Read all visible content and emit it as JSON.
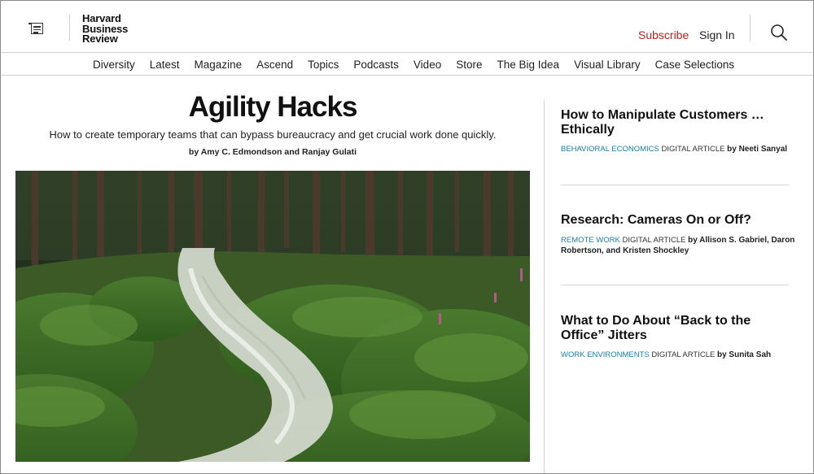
{
  "header": {
    "logo_lines": [
      "Harvard",
      "Business",
      "Review"
    ],
    "subscribe_label": "Subscribe",
    "signin_label": "Sign In",
    "menu_icon": "menu-icon",
    "search_icon": "search-icon",
    "accent_color": "#c0221b"
  },
  "nav": {
    "items": [
      "Diversity",
      "Latest",
      "Magazine",
      "Ascend",
      "Topics",
      "Podcasts",
      "Video",
      "Store",
      "The Big Idea",
      "Visual Library",
      "Case Selections"
    ]
  },
  "main": {
    "title": "Agility Hacks",
    "dek": "How to create temporary teams that can bypass bureaucracy and get crucial work done quickly.",
    "byline": "by Amy C. Edmondson and Ranjay Gulati"
  },
  "sidebar": {
    "items": [
      {
        "title": "How to Manipulate Customers … Ethically",
        "topic": "BEHAVIORAL ECONOMICS",
        "type": "DIGITAL ARTICLE",
        "author": "by Neeti Sanyal"
      },
      {
        "title": "Research: Cameras On or Off?",
        "topic": "REMOTE WORK",
        "type": "DIGITAL ARTICLE",
        "author": "by Allison S. Gabriel, Daron Robertson, and Kristen Shockley"
      },
      {
        "title": "What to Do About “Back to the Office” Jitters",
        "topic": "WORK ENVIRONMENTS",
        "type": "DIGITAL ARTICLE",
        "author": "by Sunita Sah"
      }
    ],
    "topic_color": "#1a80aa"
  }
}
